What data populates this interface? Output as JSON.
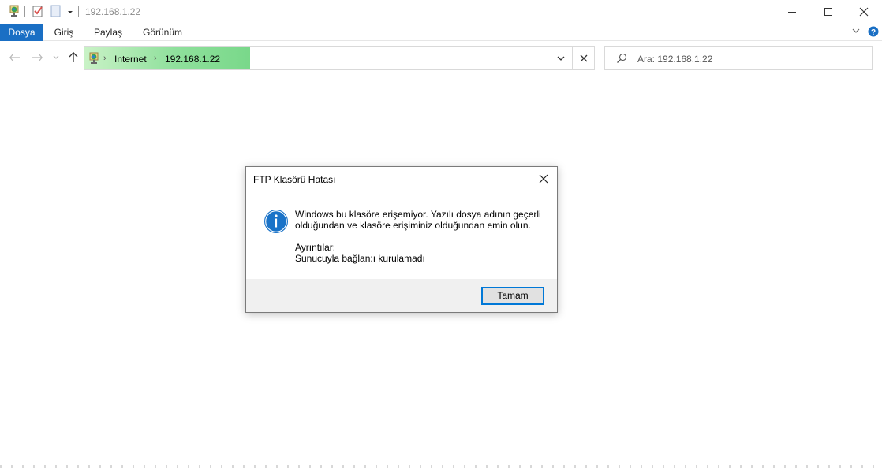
{
  "window": {
    "title": "192.168.1.22",
    "controls": {
      "minimize_icon": "minimize-icon",
      "maximize_icon": "maximize-icon",
      "close_icon": "close-icon"
    }
  },
  "ribbon": {
    "tabs": [
      {
        "label": "Dosya",
        "active": true
      },
      {
        "label": "Giriş",
        "active": false
      },
      {
        "label": "Paylaş",
        "active": false
      },
      {
        "label": "Görünüm",
        "active": false
      }
    ],
    "active_color": "#1a6fc4"
  },
  "address": {
    "crumbs": [
      "Internet",
      "192.168.1.22"
    ],
    "highlight_color": "#79d88a"
  },
  "search": {
    "placeholder": "Ara: 192.168.1.22"
  },
  "dialog": {
    "title": "FTP Klasörü Hatası",
    "message": "Windows bu klasöre erişemiyor.  Yazılı dosya adının geçerli olduğundan ve klasöre erişiminiz olduğundan emin olun.",
    "details_label": "Ayrıntılar:",
    "details_text": "Sunucuyla bağlan:ı kurulamadı",
    "ok_label": "Tamam",
    "accent_color": "#0078d7"
  }
}
